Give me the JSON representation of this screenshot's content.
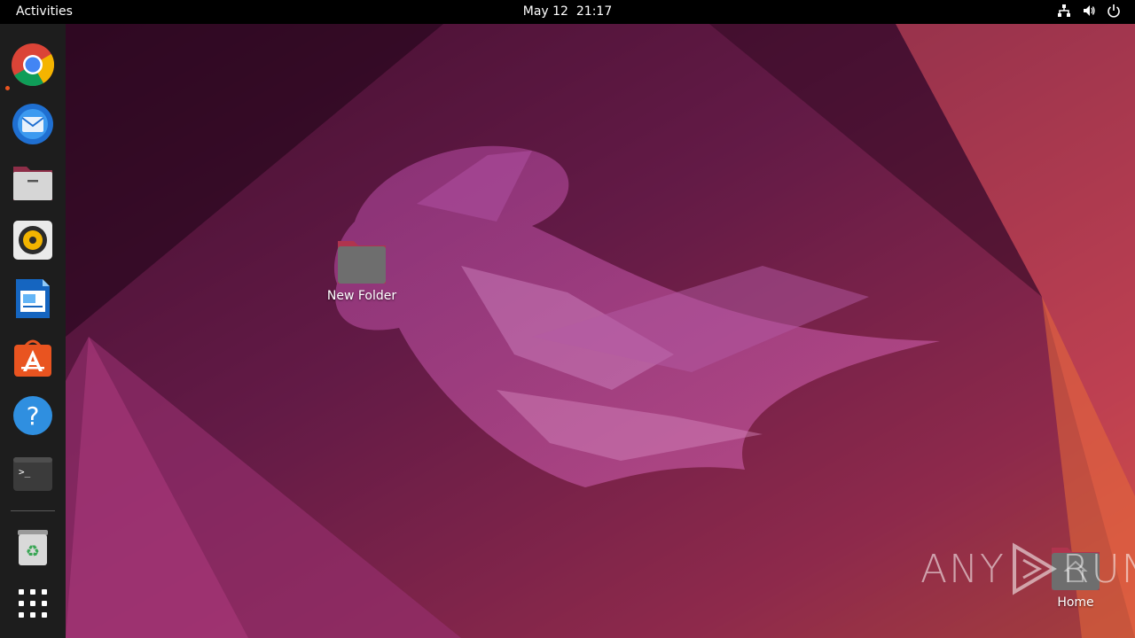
{
  "topbar": {
    "activities_label": "Activities",
    "date": "May 12",
    "time": "21:17",
    "tray_icons": [
      "network-icon",
      "volume-icon",
      "power-icon"
    ]
  },
  "dock": {
    "items": [
      {
        "name": "chrome",
        "icon": "chrome-icon",
        "running": true
      },
      {
        "name": "thunderbird",
        "icon": "thunderbird-icon"
      },
      {
        "name": "files",
        "icon": "files-icon"
      },
      {
        "name": "rhythmbox",
        "icon": "rhythmbox-icon"
      },
      {
        "name": "libreoffice-writer",
        "icon": "writer-icon"
      },
      {
        "name": "ubuntu-software",
        "icon": "software-icon"
      },
      {
        "name": "help",
        "icon": "help-icon"
      },
      {
        "name": "terminal",
        "icon": "terminal-icon"
      },
      {
        "name": "trash",
        "icon": "trash-icon"
      },
      {
        "name": "show-apps",
        "icon": "app-grid-icon"
      }
    ]
  },
  "desktop": {
    "icons": [
      {
        "label": "New Folder",
        "icon": "folder-icon"
      },
      {
        "label": "Home",
        "icon": "home-folder-icon"
      }
    ]
  },
  "watermark": {
    "left": "ANY",
    "right": "RUN"
  },
  "colors": {
    "accent": "#e95420",
    "topbar": "#000000",
    "dock": "#1d1d1d"
  }
}
